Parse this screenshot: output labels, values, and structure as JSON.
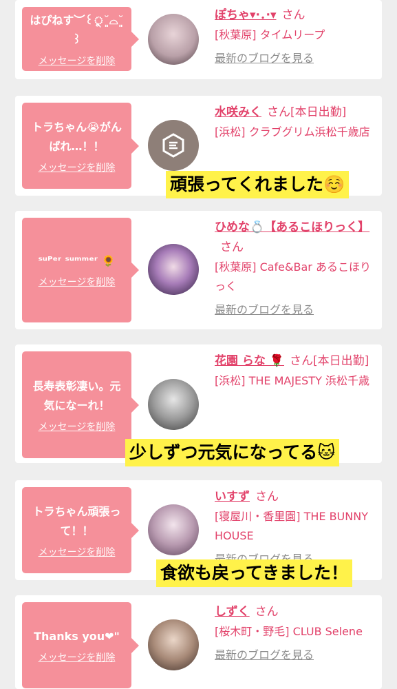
{
  "common": {
    "delete_label": "メッセージを削除",
    "san": "さん",
    "blog_label": "最新のブログを見る"
  },
  "cards": [
    {
      "message": "はぴねす︶꒰ু˘͈⌓˘͈꒱",
      "name": "ぽちゃ▾·．·▾",
      "suffix": "",
      "shop": "[秋葉原] タイムリープ"
    },
    {
      "message": "トラちゃん😭がんばれ…！！",
      "name": "水咲みく",
      "suffix": "[本日出勤]",
      "shop": "[浜松] クラブグリム浜松千歳店"
    },
    {
      "message": "ˢᵘᴾᵉʳ ˢᵘᵐᵐᵉʳ 🌻",
      "name": "ひめな💍【あるこほりっく】",
      "suffix": "",
      "shop": "[秋葉原] Cafe&Bar あるこほりっく"
    },
    {
      "message": "長寿表彰凄い。元気になーれ！",
      "name": "花園 らな 🌹",
      "suffix": "[本日出勤]",
      "shop": "[浜松] THE MAJESTY 浜松千歳"
    },
    {
      "message": "トラちゃん頑張って！！",
      "name": "いすず",
      "suffix": "",
      "shop": "[寝屋川・香里園] THE BUNNY HOUSE"
    },
    {
      "message": "Thanks you❤︎\"",
      "name": "しずく",
      "suffix": "",
      "shop": "[桜木町・野毛] CLUB Selene"
    }
  ],
  "captions": {
    "c1": "頑張ってくれました☺️",
    "c2": "少しずつ元気になってる🐱",
    "c3": "食欲も戻ってきました！"
  },
  "colors": {
    "bubble": "#f5909a",
    "name": "#e2426a",
    "caption_bg": "#fff24a",
    "page_bg": "#eeeeee"
  }
}
